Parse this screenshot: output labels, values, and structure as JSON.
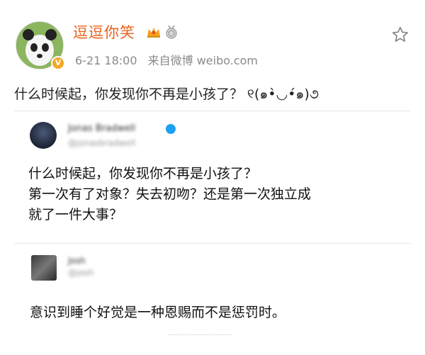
{
  "post": {
    "author": "逗逗你笑",
    "time": "6-21 18:00",
    "source": "来自微博 weibo.com",
    "text": "什么时候起，你发现你不再是小孩了？ ୧(๑•̀◡•́๑)૭"
  },
  "quotes": [
    {
      "name": "Jonas Bradwell",
      "handle": "@jonasbradwell",
      "lines": [
        "什么时候起，你发现你不再是小孩了？",
        "第一次有了对象？失去初吻？还是第一次独立成",
        "就了一件大事？"
      ]
    },
    {
      "name": "Josh",
      "handle": "@josh",
      "text": "意识到睡个好觉是一种恩赐而不是惩罚时。"
    }
  ],
  "colors": {
    "accent": "#e8611b",
    "meta": "#8a8a8a",
    "verified_blue": "#1da1f2",
    "verified_orange": "#f5a623"
  },
  "icons": [
    "avatar-panda-icon",
    "crown-icon",
    "medal-icon",
    "star-icon",
    "verified-icon"
  ]
}
